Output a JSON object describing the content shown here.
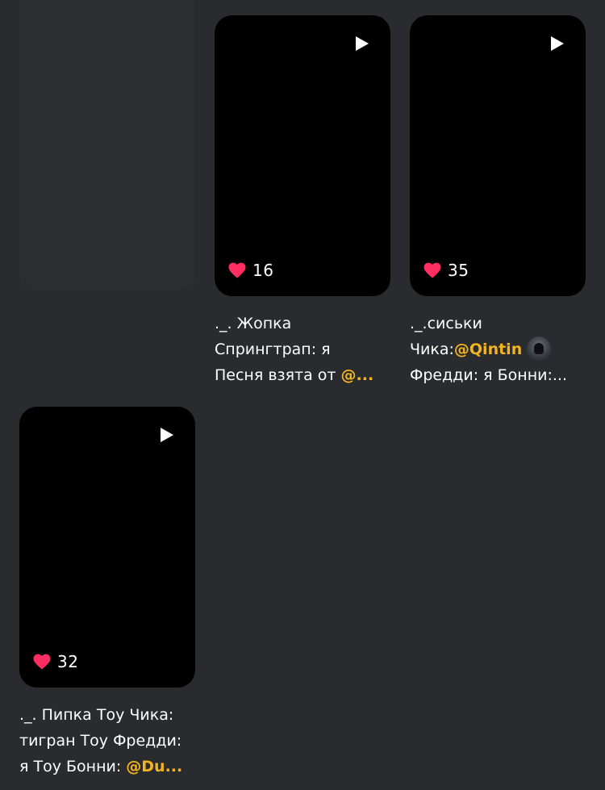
{
  "colors": {
    "background": "#2a2b2f",
    "thumbnail": "#000000",
    "heart": "#ff2d62",
    "mention": "#f2b51d",
    "text": "#ffffff"
  },
  "icons": {
    "play": "play-icon",
    "like": "heart-icon"
  },
  "videos": [
    {
      "likes": "16",
      "caption_lines": [
        "._. Жопка",
        "Спрингтрап: я",
        "Песня взята от "
      ],
      "mention": "@..."
    },
    {
      "likes": "35",
      "caption_lines": [
        "._.сиськи",
        "Чика:",
        "Фредди: я Бонни:..."
      ],
      "mention": "@Qintin"
    },
    {
      "likes": "32",
      "caption_lines": [
        "._. Пипка Тоу Чика:",
        "тигран Тоу Фредди:",
        "я Тоу Бонни: "
      ],
      "mention": "@Du..."
    }
  ]
}
